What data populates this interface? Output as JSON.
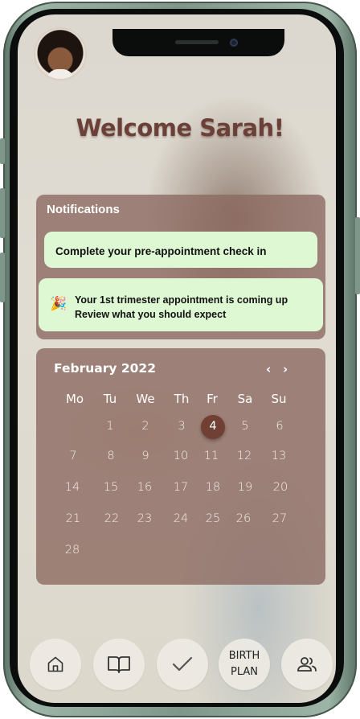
{
  "header": {
    "welcome": "Welcome Sarah!"
  },
  "notifications": {
    "title": "Notifications",
    "items": [
      {
        "text": "Complete your pre-appointment  check in"
      },
      {
        "icon": "party-popper-icon",
        "line1": "Your  1st trimester appointment is coming up",
        "line2": "Review what you should expect"
      }
    ]
  },
  "calendar": {
    "month": "February 2022",
    "prev": "‹",
    "next": "›",
    "weekdays": [
      "Mo",
      "Tu",
      "We",
      "Th",
      "Fr",
      "Sa",
      "Su"
    ],
    "days": [
      "1",
      "2",
      "3",
      "4",
      "5",
      "6",
      "7",
      "8",
      "9",
      "10",
      "11",
      "12",
      "13",
      "14",
      "15",
      "16",
      "17",
      "18",
      "19",
      "20",
      "21",
      "22",
      "23",
      "24",
      "25",
      "26",
      "27",
      "28"
    ],
    "selected_day": "4"
  },
  "nav": {
    "home": "home-icon",
    "learn": "book-icon",
    "checklist": "checkmark-icon",
    "birth_plan_line1": "BIRTH",
    "birth_plan_line2": "PLAN",
    "community": "people-icon"
  },
  "colors": {
    "title": "#6a4038",
    "panel": "#8c6a62",
    "card": "#dff8d4",
    "selected_day": "#704034",
    "phone_frame": "#7f968a"
  }
}
